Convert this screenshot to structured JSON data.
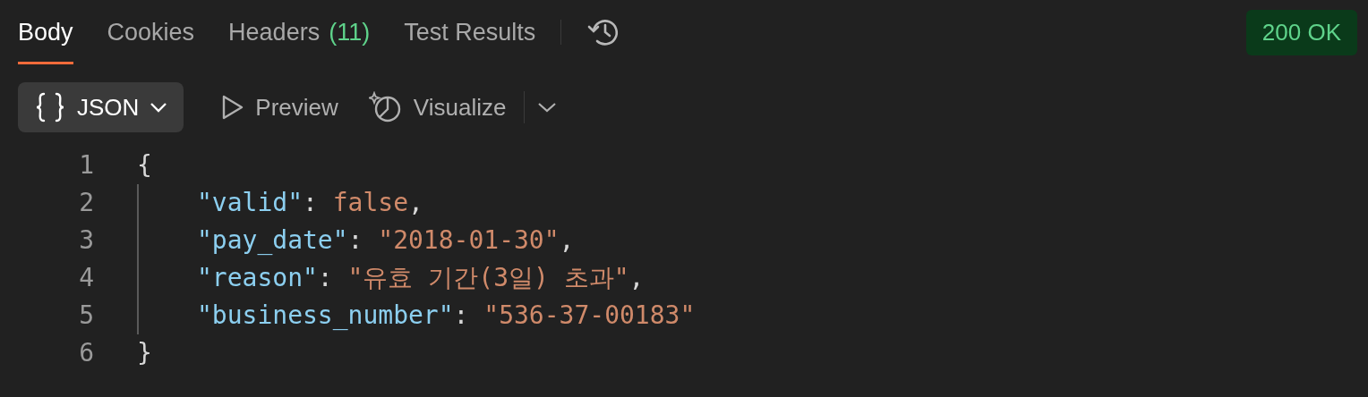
{
  "tabs": [
    {
      "label": "Body",
      "selected": true
    },
    {
      "label": "Cookies",
      "selected": false
    },
    {
      "label": "Headers",
      "count": "(11)",
      "selected": false
    },
    {
      "label": "Test Results",
      "selected": false
    }
  ],
  "status": "200 OK",
  "toolbar": {
    "format": "JSON",
    "views": [
      {
        "kind": "preview",
        "label": "Preview"
      },
      {
        "kind": "visualize",
        "label": "Visualize"
      }
    ]
  },
  "code": [
    {
      "number": "1",
      "tokens": [
        {
          "kind": "punct",
          "text": "{"
        }
      ],
      "children": [
        {
          "number": "2",
          "tokens": [
            {
              "kind": "key",
              "text": "\"valid\""
            },
            {
              "kind": "punct",
              "text": ": "
            },
            {
              "kind": "literal",
              "text": "false"
            },
            {
              "kind": "punct",
              "text": ","
            }
          ]
        },
        {
          "number": "3",
          "tokens": [
            {
              "kind": "key",
              "text": "\"pay_date\""
            },
            {
              "kind": "punct",
              "text": ": "
            },
            {
              "kind": "string",
              "text": "\"2018-01-30\""
            },
            {
              "kind": "punct",
              "text": ","
            }
          ]
        },
        {
          "number": "4",
          "tokens": [
            {
              "kind": "key",
              "text": "\"reason\""
            },
            {
              "kind": "punct",
              "text": ": "
            },
            {
              "kind": "string",
              "text": "\"유효 기간(3일) 초과\""
            },
            {
              "kind": "punct",
              "text": ","
            }
          ]
        },
        {
          "number": "5",
          "tokens": [
            {
              "kind": "key",
              "text": "\"business_number\""
            },
            {
              "kind": "punct",
              "text": ": "
            },
            {
              "kind": "string",
              "text": "\"536-37-00183\""
            }
          ]
        }
      ]
    },
    {
      "number": "6",
      "tokens": [
        {
          "kind": "punct",
          "text": "}"
        }
      ]
    }
  ]
}
